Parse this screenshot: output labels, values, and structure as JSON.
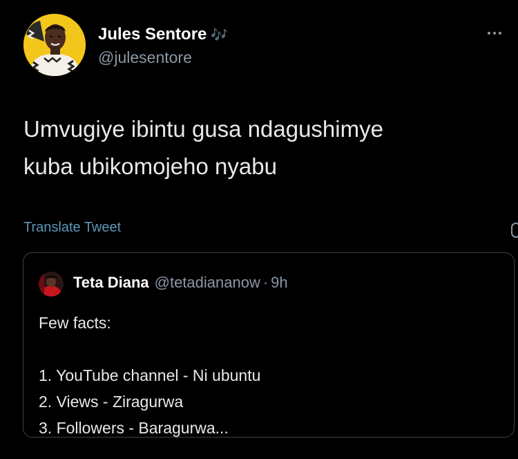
{
  "tweet": {
    "author": {
      "name": "Jules Sentore",
      "name_emoji": "🎶",
      "handle": "@julesentore",
      "avatar_icon": "profile-photo"
    },
    "more_icon": "more-dots-icon",
    "text_lines": [
      "Umvugiye ibintu gusa ndagushimye",
      "kuba ubikomojeho nyabu"
    ],
    "translate_label": "Translate Tweet"
  },
  "quoted": {
    "name": "Teta Diana",
    "handle": "@tetadiananow",
    "separator": "·",
    "time": "9h",
    "body": {
      "intro": "Few facts:",
      "items": [
        "1. YouTube channel - Ni ubuntu",
        "2. Views - Ziragurwa",
        "3. Followers - Baragurwa..."
      ]
    }
  },
  "colors": {
    "background": "#000000",
    "text": "#e7e9ea",
    "secondary": "#8b98a5",
    "link": "#5d97b8",
    "border": "#3e4144",
    "avatar_bg": "#f3c61c"
  }
}
